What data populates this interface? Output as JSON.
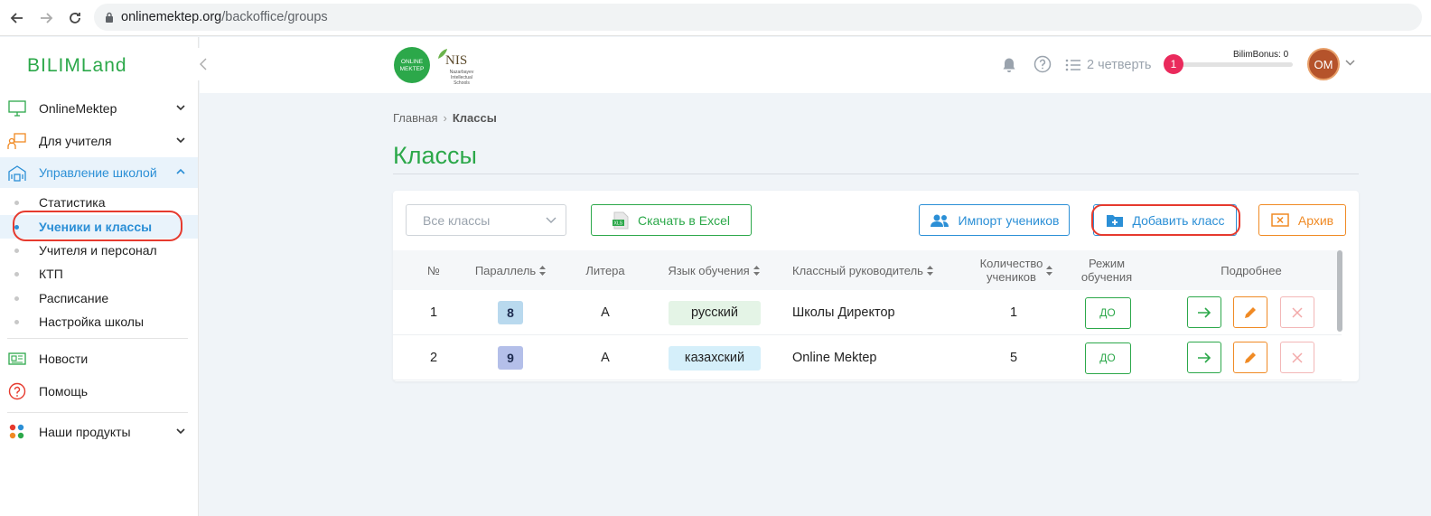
{
  "browser": {
    "url_host": "onlinemektep.org",
    "url_path": "/backoffice/groups"
  },
  "sidebar": {
    "logo": "BILIMLand",
    "menu": [
      {
        "label": "OnlineMektep",
        "icon": "monitor-icon"
      },
      {
        "label": "Для учителя",
        "icon": "teacher-board-icon"
      },
      {
        "label": "Управление школой",
        "icon": "school-building-icon"
      }
    ],
    "submenu": [
      {
        "label": "Статистика"
      },
      {
        "label": "Ученики и классы"
      },
      {
        "label": "Учителя и персонал"
      },
      {
        "label": "КТП"
      },
      {
        "label": "Расписание"
      },
      {
        "label": "Настройка школы"
      }
    ],
    "news": "Новости",
    "help": "Помощь",
    "products": "Наши продукты"
  },
  "header": {
    "om_logo_line1": "ONLINE",
    "om_logo_line2": "MEKTEP",
    "nis_logo": "NIS",
    "nis_sub": "Nazarbayev Intellectual Schools",
    "quarter": "2 четверть",
    "notifications_count": "1",
    "bilim_bonus": "BilimBonus: 0",
    "bonus_progress": 0,
    "avatar_initials": "OM"
  },
  "breadcrumb": {
    "home": "Главная",
    "current": "Классы"
  },
  "page": {
    "title": "Классы"
  },
  "toolbar": {
    "filter_value": "Все классы",
    "excel_label": "Скачать в Excel",
    "import_label": "Импорт учеников",
    "add_label": "Добавить класс",
    "archive_label": "Архив"
  },
  "table": {
    "headers": {
      "num": "№",
      "parallel": "Параллель",
      "litera": "Литера",
      "language": "Язык обучения",
      "teacher": "Классный руководитель",
      "count_l1": "Количество",
      "count_l2": "учеников",
      "mode_l1": "Режим",
      "mode_l2": "обучения",
      "details": "Подробнее"
    },
    "rows": [
      {
        "num": "1",
        "parallel": "8",
        "litera": "А",
        "language": "русский",
        "teacher": "Школы Директор",
        "count": "1",
        "mode": "ДО",
        "grade_color": "#b9d9ee",
        "lang_color": "#e4f4e6"
      },
      {
        "num": "2",
        "parallel": "9",
        "litera": "А",
        "language": "казахский",
        "teacher": "Online Mektep",
        "count": "5",
        "mode": "ДО",
        "grade_color": "#b4bfe9",
        "lang_color": "#d5effa"
      }
    ]
  },
  "colors": {
    "brand_green": "#2ca84a",
    "accent_blue": "#2b8fd6",
    "accent_orange": "#f08a24",
    "highlight_red": "#e63a2e"
  }
}
